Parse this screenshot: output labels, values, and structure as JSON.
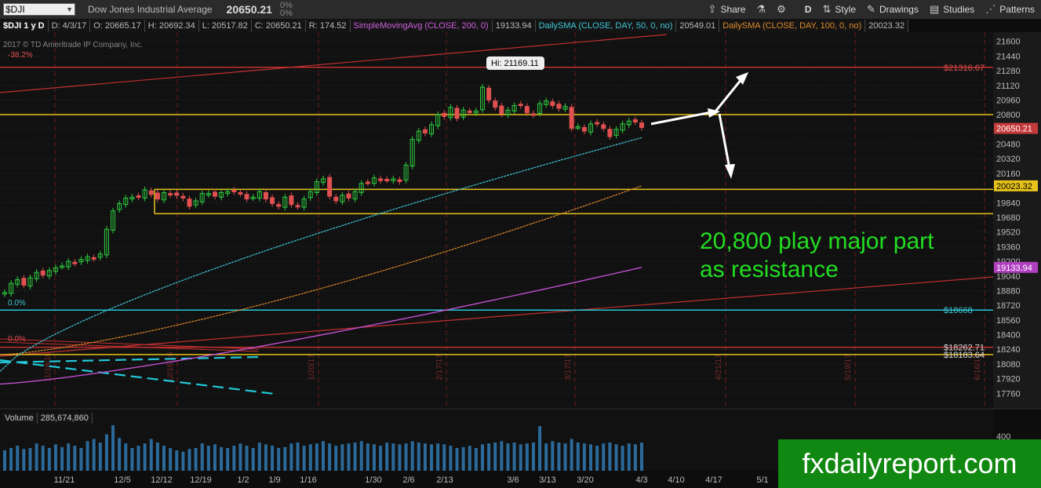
{
  "toolbar": {
    "symbol": "$DJI",
    "description": "Dow Jones Industrial Average",
    "last_price": "20650.21",
    "change": "0%",
    "change_pct": "0%",
    "share_label": "Share",
    "period_label": "D",
    "style_label": "Style",
    "drawings_label": "Drawings",
    "studies_label": "Studies",
    "patterns_label": "Patterns"
  },
  "info": {
    "symbol_period": "$DJI 1 y D",
    "date": "D: 4/3/17",
    "open": "O: 20665.17",
    "high": "H: 20692.34",
    "low": "L: 20517.82",
    "close": "C: 20650.21",
    "range": "R: 174.52",
    "sma200_name": "SimpleMovingAvg (CLOSE, 200, 0)",
    "sma200_value": "19133.94",
    "sma50_name": "DailySMA (CLOSE, DAY, 50, 0, no)",
    "sma50_value": "20549.01",
    "sma100_name": "DailySMA (CLOSE, DAY, 100, 0, no)",
    "sma100_value": "20023.32"
  },
  "copyright": "2017 © TD Ameritrade IP Company, Inc.",
  "fib_labels": {
    "top": "-38.2%",
    "mid": "0.0%",
    "low": "0.0%"
  },
  "hi_callout": "Hi: 21169.11",
  "volume": {
    "label": "Volume",
    "value": "285,674,860"
  },
  "annotation": {
    "line1": "20,800 play major part",
    "line2": "as resistance"
  },
  "watermark": "fxdailyreport.com",
  "colors": {
    "up": "#2ecc40",
    "down": "#e05050",
    "sma50": "#3fc7d6",
    "sma100": "#e08a2a",
    "sma200": "#c050d0",
    "support": "#e6c21a",
    "red_line": "#c23030",
    "cyan_line": "#22c8d8"
  },
  "chart_data": {
    "type": "candlestick",
    "title": "$DJI 1 y D",
    "ylim": [
      17600,
      21700
    ],
    "y_ticks": [
      21600,
      21440,
      21280,
      21120,
      20960,
      20800,
      20640,
      20480,
      20320,
      20160,
      20000,
      19840,
      19680,
      19520,
      19360,
      19200,
      19040,
      18880,
      18720,
      18560,
      18400,
      18240,
      18080,
      17920,
      17760
    ],
    "x_tick_labels": [
      "11/21",
      "12/5",
      "12/12",
      "12/19",
      "1/2",
      "1/9",
      "1/16",
      "1/30",
      "2/6",
      "2/13",
      "3/6",
      "3/13",
      "3/20",
      "4/3",
      "4/10",
      "4/17",
      "5/1"
    ],
    "month_markers": [
      "11/18/16",
      "12/16/16",
      "1/20/17",
      "2/17/17",
      "3/17/17",
      "4/21/17",
      "5/19/17",
      "6/16/17"
    ],
    "price_badges": [
      {
        "label": "$21316.67",
        "value": 21316.67
      },
      {
        "label": "20650.21",
        "value": 20650.21
      },
      {
        "label": "20023.32",
        "value": 20023.32
      },
      {
        "label": "19133.94",
        "value": 19133.94
      },
      {
        "label": "$18668",
        "value": 18668
      },
      {
        "label": "$18262.71",
        "value": 18262.71
      },
      {
        "label": "$18183.64",
        "value": 18183.64
      }
    ],
    "horizontal_levels": [
      {
        "name": "resistance 20,800",
        "value": 20800,
        "color": "#e6c21a"
      },
      {
        "name": "support upper",
        "value": 19985,
        "color": "#e6c21a"
      },
      {
        "name": "support lower",
        "value": 19720,
        "color": "#e6c21a"
      },
      {
        "name": "fib -38.2%",
        "value": 21316.67,
        "color": "#c23030"
      },
      {
        "name": "level 18668",
        "value": 18668,
        "color": "#22c8d8"
      },
      {
        "name": "level 18262",
        "value": 18262.71,
        "color": "#c23030"
      },
      {
        "name": "level 18183",
        "value": 18183.64,
        "color": "#e6c21a"
      }
    ],
    "closes": [
      18860,
      18960,
      19000,
      18940,
      19020,
      19080,
      19050,
      19100,
      19130,
      19150,
      19200,
      19180,
      19220,
      19250,
      19230,
      19280,
      19550,
      19750,
      19830,
      19890,
      19900,
      19900,
      19980,
      19930,
      19880,
      19950,
      19930,
      19920,
      19890,
      19800,
      19860,
      19940,
      19940,
      19910,
      19950,
      19960,
      19960,
      19940,
      19880,
      19900,
      19960,
      19880,
      19830,
      19800,
      19900,
      19820,
      19800,
      19880,
      19960,
      20070,
      20100,
      19910,
      19860,
      19920,
      19890,
      19960,
      20050,
      20060,
      20110,
      20080,
      20090,
      20100,
      20070,
      20250,
      20530,
      20620,
      20600,
      20690,
      20800,
      20780,
      20880,
      20760,
      20850,
      20830,
      20840,
      21100,
      20960,
      20880,
      20810,
      20850,
      20900,
      20900,
      20820,
      20800,
      20920,
      20950,
      20900,
      20870,
      20890,
      20650,
      20670,
      20620,
      20700,
      20700,
      20650,
      20560,
      20640,
      20700,
      20730,
      20720,
      20660
    ],
    "sma50_range": [
      18000,
      20549.01
    ],
    "sma100_range": [
      18180,
      20023.32
    ],
    "sma200_range": [
      17860,
      19133.94
    ],
    "volume_max": 400000000,
    "volume_last": 285674860
  }
}
